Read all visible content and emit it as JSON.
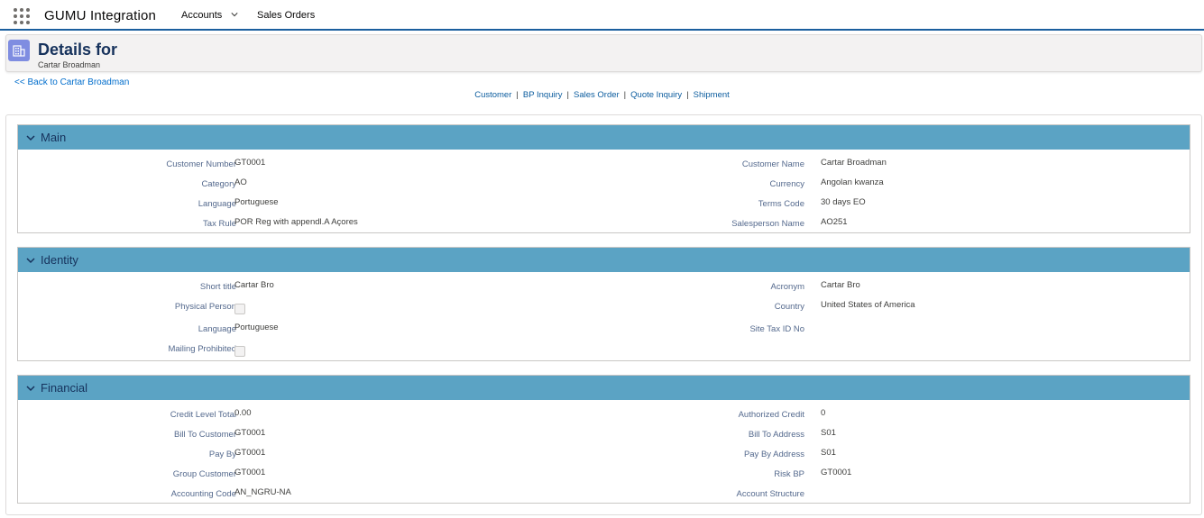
{
  "app": {
    "name": "GUMU Integration"
  },
  "nav": {
    "accounts": "Accounts",
    "sales_orders": "Sales Orders"
  },
  "header": {
    "title": "Details for",
    "subtitle": "Cartar Broadman"
  },
  "back_link": "<< Back to Cartar Broadman",
  "links": [
    "Customer",
    "BP Inquiry",
    "Sales Order",
    "Quote Inquiry",
    "Shipment"
  ],
  "link_separator": "|",
  "sections": {
    "main": {
      "title": "Main",
      "left": [
        {
          "label": "Customer Number",
          "value": "GT0001"
        },
        {
          "label": "Category",
          "value": "AO"
        },
        {
          "label": "Language",
          "value": "Portuguese"
        },
        {
          "label": "Tax Rule",
          "value": "POR Reg with appendl.A Açores"
        }
      ],
      "right": [
        {
          "label": "Customer Name",
          "value": "Cartar Broadman"
        },
        {
          "label": "Currency",
          "value": "Angolan kwanza"
        },
        {
          "label": "Terms Code",
          "value": "30 days EO"
        },
        {
          "label": "Salesperson Name",
          "value": "AO251"
        }
      ]
    },
    "identity": {
      "title": "Identity",
      "left": [
        {
          "label": "Short title",
          "value": "Cartar Bro"
        },
        {
          "label": "Physical Person",
          "value": ""
        },
        {
          "label": "Language",
          "value": "Portuguese"
        },
        {
          "label": "Mailing Prohibited",
          "value": ""
        }
      ],
      "right": [
        {
          "label": "Acronym",
          "value": "Cartar Bro"
        },
        {
          "label": "Country",
          "value": "United States of America"
        },
        {
          "label": "Site Tax ID No",
          "value": ""
        }
      ]
    },
    "financial": {
      "title": "Financial",
      "left": [
        {
          "label": "Credit Level Total",
          "value": "0.00"
        },
        {
          "label": "Bill To Customer",
          "value": "GT0001"
        },
        {
          "label": "Pay By",
          "value": "GT0001"
        },
        {
          "label": "Group Customer",
          "value": "GT0001"
        },
        {
          "label": "Accounting Code",
          "value": "AN_NGRU-NA"
        }
      ],
      "right": [
        {
          "label": "Authorized Credit",
          "value": "0"
        },
        {
          "label": "Bill To Address",
          "value": "S01"
        },
        {
          "label": "Pay By Address",
          "value": "S01"
        },
        {
          "label": "Risk BP",
          "value": "GT0001"
        },
        {
          "label": "Account Structure",
          "value": ""
        }
      ]
    }
  },
  "colors": {
    "section_header": "#5ba3c4",
    "nav_border": "#1b5f9e",
    "link": "#0b5c9e",
    "header_icon": "#7f8de1"
  }
}
